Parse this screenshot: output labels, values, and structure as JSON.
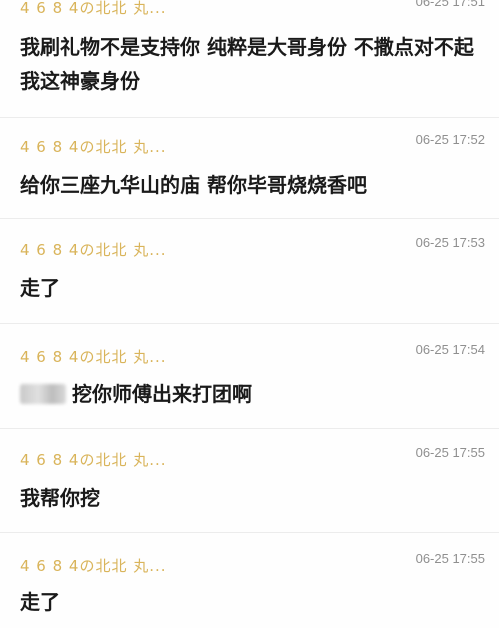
{
  "messages": [
    {
      "user": "4 6 8 4の北北 丸...",
      "time": "06-25 17:51",
      "text": "我刷礼物不是支持你 纯粹是大哥身份 不撒点对不起我这神豪身份"
    },
    {
      "user": "4 6 8 4の北北 丸...",
      "time": "06-25 17:52",
      "text": "给你三座九华山的庙 帮你毕哥烧烧香吧"
    },
    {
      "user": "4 6 8 4の北北 丸...",
      "time": "06-25 17:53",
      "text": "走了"
    },
    {
      "user": "4 6 8 4の北北 丸...",
      "time": "06-25 17:54",
      "text": "挖你师傅出来打团啊",
      "mention_redacted": true
    },
    {
      "user": "4 6 8 4の北北 丸...",
      "time": "06-25 17:55",
      "text": "我帮你挖"
    },
    {
      "user": "4 6 8 4の北北 丸...",
      "time": "06-25 17:55",
      "text": "走了"
    }
  ]
}
